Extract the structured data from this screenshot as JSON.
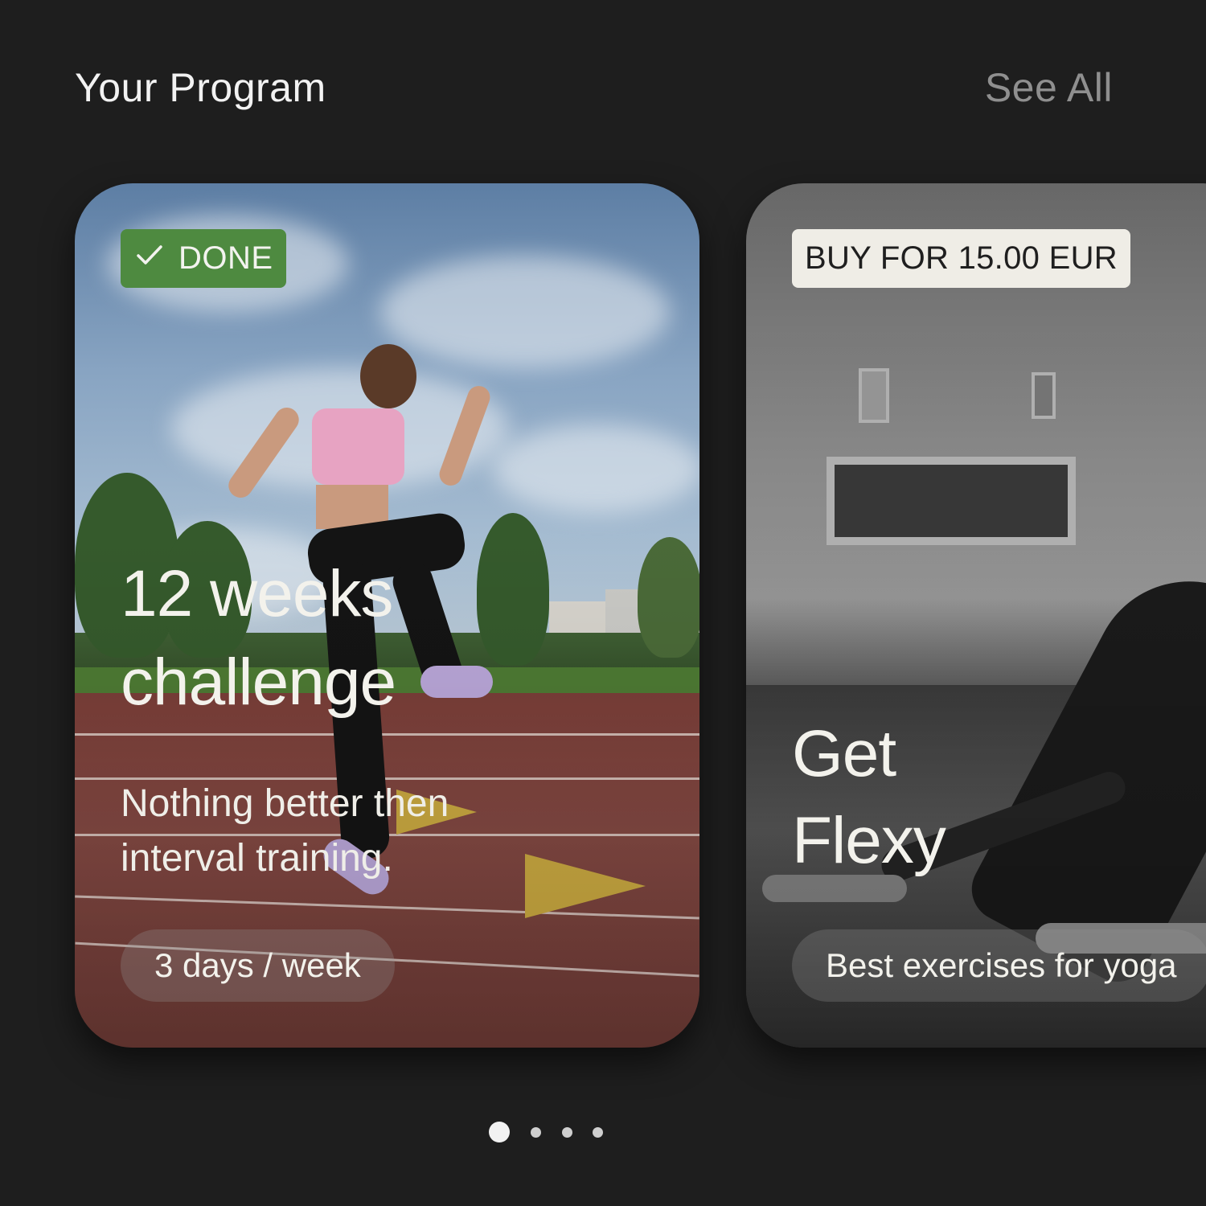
{
  "header": {
    "title": "Your Program",
    "see_all_label": "See All"
  },
  "cards": [
    {
      "badge": "DONE",
      "title_line1": "12 weeks",
      "title_line2": "challenge",
      "description_line1": "Nothing better then",
      "description_line2": "interval training.",
      "frequency": "3 days / week"
    },
    {
      "badge": "BUY FOR 15.00 EUR",
      "title_line1": "Get",
      "title_line2": "Flexy",
      "subtitle": "Best exercises for yoga"
    }
  ],
  "pagination": {
    "total": 4,
    "active_index": 0
  },
  "colors": {
    "background": "#1e1e1e",
    "done_badge": "#4e8a40",
    "buy_badge": "#efede6",
    "muted_text": "#8f8f8f"
  },
  "icons": {
    "done_badge_icon": "checkmark-icon"
  }
}
